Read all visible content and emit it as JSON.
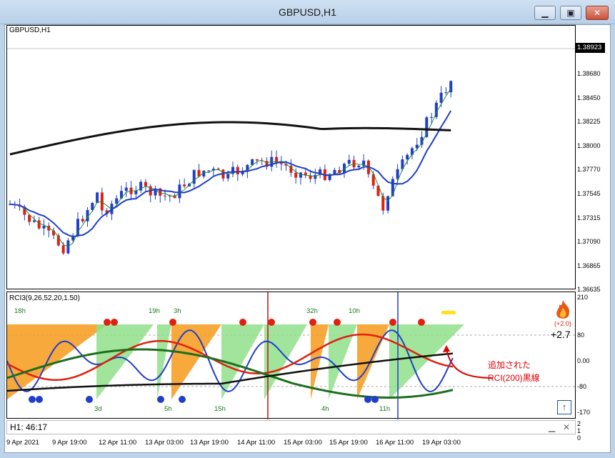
{
  "window": {
    "title": "GBPUSD,H1",
    "buttons": [
      "minimize",
      "maximize",
      "close"
    ]
  },
  "main_chart": {
    "label": "GBPUSD,H1",
    "current_price": "1.38923",
    "price_ticks": [
      "1.38680",
      "1.38450",
      "1.38225",
      "1.38000",
      "1.37770",
      "1.37545",
      "1.37315",
      "1.37090",
      "1.36865",
      "1.36635"
    ]
  },
  "indicator": {
    "label": "RCI3(9,26,52,20,1.50)",
    "scale": [
      "210",
      "80",
      "0.00",
      "-80",
      "-170"
    ],
    "level_label": "(+2.0)",
    "level_value": "+2.7",
    "top_annotations": [
      "18h",
      "19h",
      "3h",
      "32h",
      "10h"
    ],
    "bottom_annotations": [
      "3d",
      "5h",
      "15h",
      "4h",
      "11h"
    ],
    "note_line1": "追加された",
    "note_line2": "RCI(200)黒線",
    "colors": {
      "green": "#1e6e1e",
      "red": "#e02010",
      "blue": "#1f3fc8",
      "black": "#111111",
      "orange": "#f79a1a",
      "lightgreen": "#8fe08a"
    }
  },
  "status": {
    "text": "H1: 46:17",
    "side_scale": [
      "2",
      "1",
      "0"
    ]
  },
  "time_axis": [
    "9 Apr 2021",
    "9 Apr 19:00",
    "12 Apr 11:00",
    "13 Apr 03:00",
    "13 Apr 19:00",
    "14 Apr 11:00",
    "15 Apr 03:00",
    "15 Apr 19:00",
    "16 Apr 11:00",
    "19 Apr 03:00"
  ]
}
